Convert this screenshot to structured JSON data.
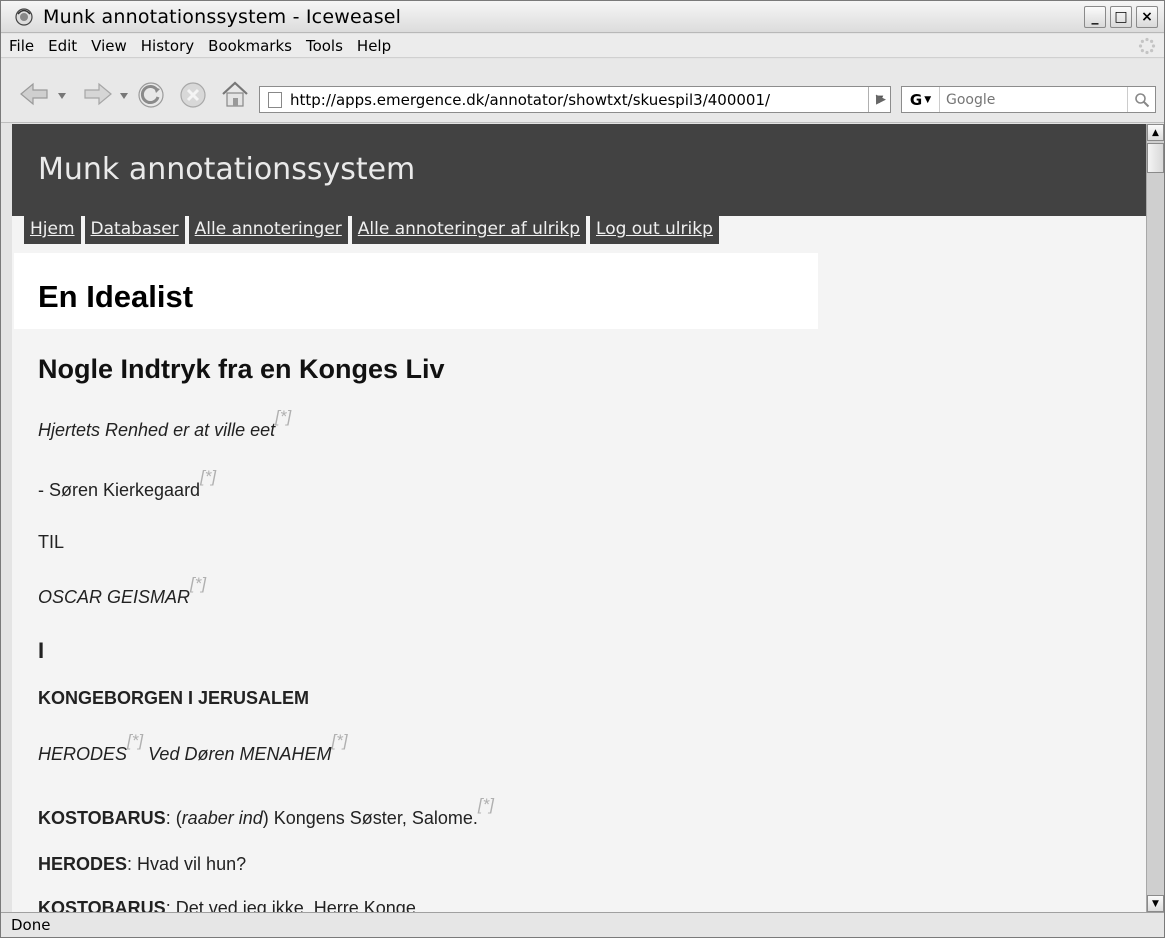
{
  "window": {
    "title": "Munk annotationssystem - Iceweasel"
  },
  "menu": [
    "File",
    "Edit",
    "View",
    "History",
    "Bookmarks",
    "Tools",
    "Help"
  ],
  "toolbar": {
    "url": "http://apps.emergence.dk/annotator/showtxt/skuespil3/400001/",
    "search_engine": "G",
    "search_placeholder": "Google"
  },
  "site": {
    "title": "Munk annotationssystem",
    "nav": [
      "Hjem",
      "Databaser",
      "Alle annoteringer",
      "Alle annoteringer af ulrikp",
      "Log out ulrikp"
    ]
  },
  "page": {
    "title": "En Idealist",
    "subtitle": "Nogle Indtryk fra en Konges Liv",
    "note_marker": "[*]",
    "epigraph": "Hjertets Renhed er at ville eet",
    "epigraph_author": "- Søren Kierkegaard",
    "dedication_to": "TIL",
    "dedication_name": "OSCAR GEISMAR",
    "act": "I",
    "setting": "KONGEBORGEN I JERUSALEM",
    "stage_herodes": "HERODES",
    "stage_middle": "Ved Døren",
    "stage_menahem": "MENAHEM",
    "lines": [
      {
        "speaker": "KOSTOBARUS",
        "sep": ": (",
        "direction": "raaber ind",
        "text": ") Kongens Søster, Salome."
      },
      {
        "speaker": "HERODES",
        "sep": ": ",
        "text": "Hvad vil hun?"
      },
      {
        "speaker": "KOSTOBARUS",
        "sep": ": ",
        "text": "Det ved jeg ikke, Herre Konge."
      }
    ]
  },
  "status": {
    "text": "Done"
  }
}
